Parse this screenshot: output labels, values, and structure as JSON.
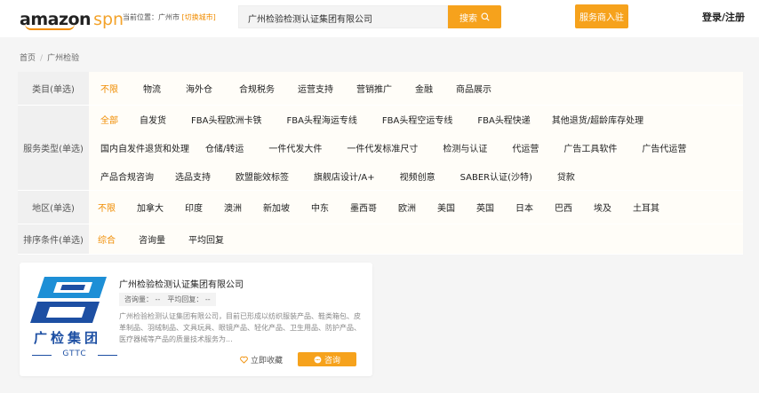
{
  "header": {
    "logo_text": "amazon",
    "logo_suffix": "spn",
    "location_label": "当前位置：广州市",
    "location_switch": "[切换城市]",
    "search_value": "广州检验检测认证集团有限公司",
    "search_button": "搜索",
    "provider_button": "服务商入驻",
    "login": "登录/注册"
  },
  "breadcrumb": {
    "home": "首页",
    "current": "广州检验"
  },
  "filters": {
    "category": {
      "label": "类目(单选)",
      "options": [
        "不限",
        "物流",
        "海外仓",
        "合规税务",
        "运营支持",
        "营销推广",
        "金融",
        "商品展示"
      ]
    },
    "service": {
      "label": "服务类型(单选)",
      "options": [
        "全部",
        "自发货",
        "FBA头程欧洲卡铁",
        "FBA头程海运专线",
        "FBA头程空运专线",
        "FBA头程快递",
        "其他退货/超龄库存处理",
        "国内自发件退货和处理",
        "仓储/转运",
        "一件代发大件",
        "一件代发标准尺寸",
        "检测与认证",
        "代运营",
        "广告工具软件",
        "广告代运营",
        "产品合规咨询",
        "选品支持",
        "欧盟能效标签",
        "旗舰店设计/A+",
        "视频创意",
        "SABER认证(沙特)",
        "贷款"
      ]
    },
    "region": {
      "label": "地区(单选)",
      "options": [
        "不限",
        "加拿大",
        "印度",
        "澳洲",
        "新加坡",
        "中东",
        "墨西哥",
        "欧洲",
        "美国",
        "英国",
        "日本",
        "巴西",
        "埃及",
        "土耳其"
      ]
    },
    "sort": {
      "label": "排序条件(单选)",
      "options": [
        "综合",
        "咨询量",
        "平均回复"
      ]
    }
  },
  "card": {
    "logo_brand": "广检集团",
    "logo_sub": "GTTC",
    "title": "广州检验检测认证集团有限公司",
    "inquiries": "咨询量： --",
    "avg_reply": "平均回复： --",
    "description": "广州检验检测认证集团有限公司，目前已形成以纺织服装产品、鞋类箱包、皮革制品、羽绒制品、文具玩具、眼镜产品、轻化产品、卫生用品、防护产品、医疗器械等产品的质量技术服务为...",
    "favorite": "立即收藏",
    "consult": "咨询"
  },
  "colors": {
    "accent": "#f6a21c",
    "active_text": "#f08c00",
    "logo_blue": "#1d4fa3"
  }
}
